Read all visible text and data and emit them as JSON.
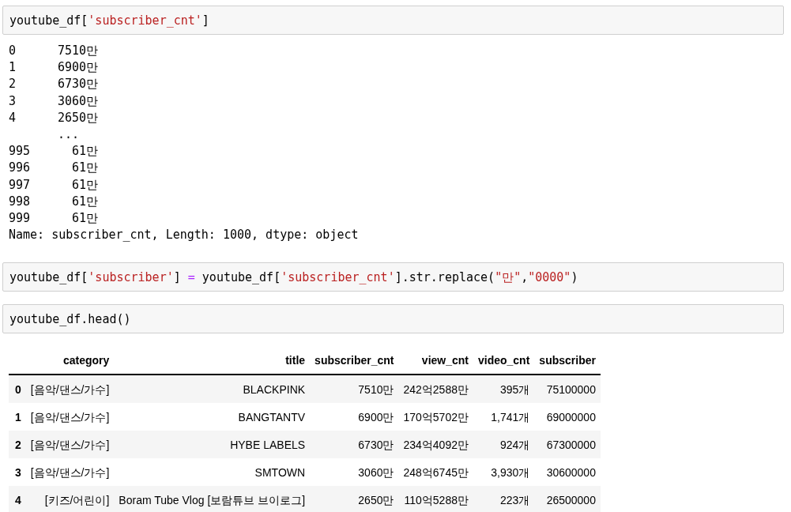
{
  "cells": [
    {
      "kind": "code",
      "tokens": [
        {
          "kind": "plain",
          "text": "youtube_df["
        },
        {
          "kind": "string",
          "text": "'subscriber_cnt'"
        },
        {
          "kind": "plain",
          "text": "]"
        }
      ]
    },
    {
      "kind": "series",
      "rows": [
        {
          "index": "0",
          "value": "7510만"
        },
        {
          "index": "1",
          "value": "6900만"
        },
        {
          "index": "2",
          "value": "6730만"
        },
        {
          "index": "3",
          "value": "3060만"
        },
        {
          "index": "4",
          "value": "2650만"
        },
        {
          "index": "",
          "value": "..."
        },
        {
          "index": "995",
          "value": "61만"
        },
        {
          "index": "996",
          "value": "61만"
        },
        {
          "index": "997",
          "value": "61만"
        },
        {
          "index": "998",
          "value": "61만"
        },
        {
          "index": "999",
          "value": "61만"
        }
      ],
      "footer": "Name: subscriber_cnt, Length: 1000, dtype: object"
    },
    {
      "kind": "code",
      "tokens": [
        {
          "kind": "plain",
          "text": "youtube_df["
        },
        {
          "kind": "string",
          "text": "'subscriber'"
        },
        {
          "kind": "plain",
          "text": "] "
        },
        {
          "kind": "operator",
          "text": "="
        },
        {
          "kind": "plain",
          "text": " youtube_df["
        },
        {
          "kind": "string",
          "text": "'subscriber_cnt'"
        },
        {
          "kind": "plain",
          "text": "].str.replace("
        },
        {
          "kind": "string",
          "text": "\"만\""
        },
        {
          "kind": "plain",
          "text": ","
        },
        {
          "kind": "string",
          "text": "\"0000\""
        },
        {
          "kind": "plain",
          "text": ")"
        }
      ]
    },
    {
      "kind": "code",
      "tokens": [
        {
          "kind": "plain",
          "text": "youtube_df.head()"
        }
      ]
    },
    {
      "kind": "dataframe",
      "columns": [
        "category",
        "title",
        "subscriber_cnt",
        "view_cnt",
        "video_cnt",
        "subscriber"
      ],
      "rows": [
        {
          "index": "0",
          "cells": [
            "[음악/댄스/가수]",
            "BLACKPINK",
            "7510만",
            "242억2588만",
            "395개",
            "75100000"
          ]
        },
        {
          "index": "1",
          "cells": [
            "[음악/댄스/가수]",
            "BANGTANTV",
            "6900만",
            "170억5702만",
            "1,741개",
            "69000000"
          ]
        },
        {
          "index": "2",
          "cells": [
            "[음악/댄스/가수]",
            "HYBE LABELS",
            "6730만",
            "234억4092만",
            "924개",
            "67300000"
          ]
        },
        {
          "index": "3",
          "cells": [
            "[음악/댄스/가수]",
            "SMTOWN",
            "3060만",
            "248억6745만",
            "3,930개",
            "30600000"
          ]
        },
        {
          "index": "4",
          "cells": [
            "[키즈/어린이]",
            "Boram Tube Vlog [보람튜브 브이로그]",
            "2650만",
            "110억5288만",
            "223개",
            "26500000"
          ]
        }
      ]
    }
  ]
}
